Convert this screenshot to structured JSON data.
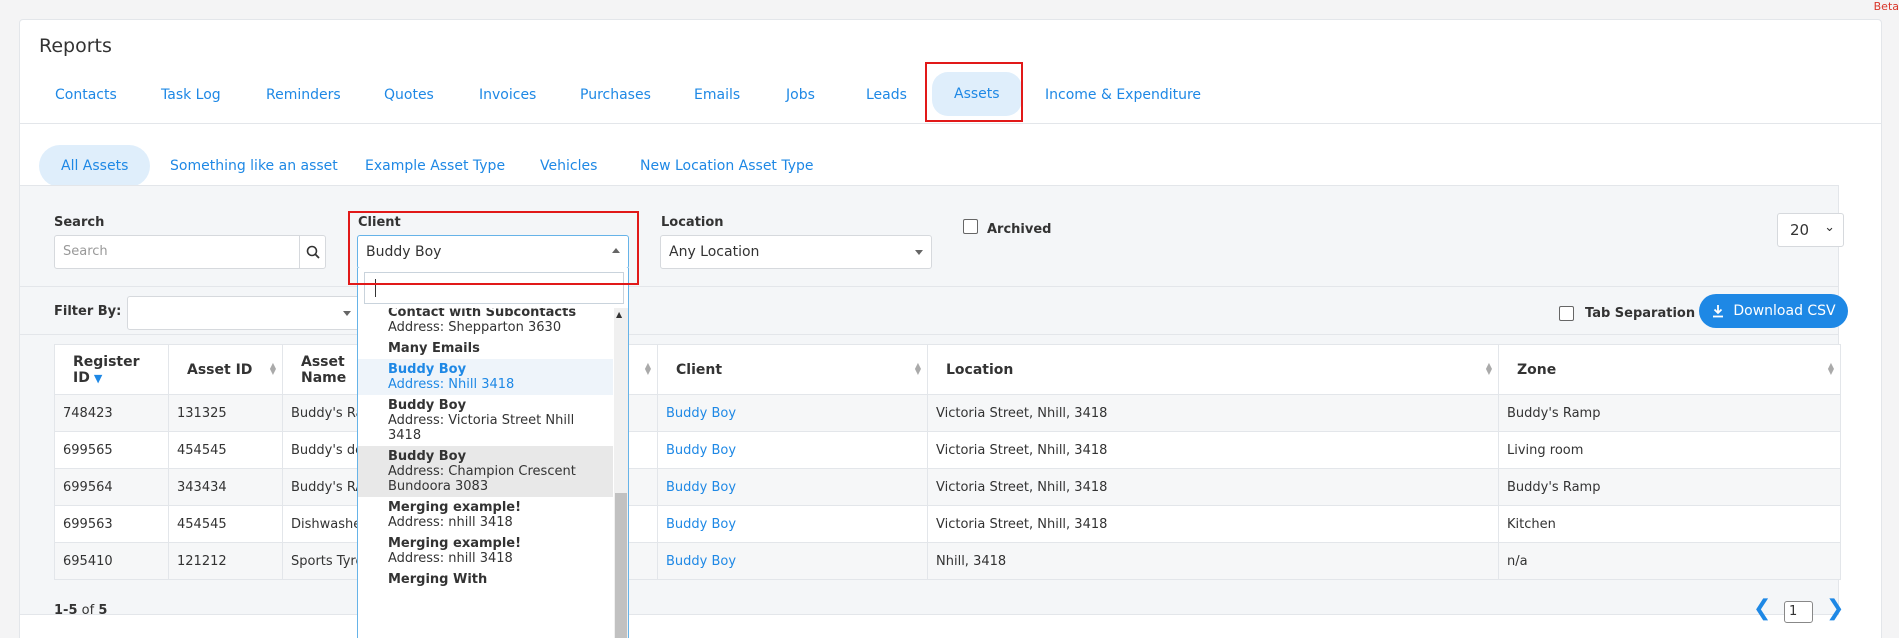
{
  "beta": "Beta",
  "page": {
    "title": "Reports"
  },
  "main_tabs": [
    {
      "label": "Contacts"
    },
    {
      "label": "Task Log"
    },
    {
      "label": "Reminders"
    },
    {
      "label": "Quotes"
    },
    {
      "label": "Invoices"
    },
    {
      "label": "Purchases"
    },
    {
      "label": "Emails"
    },
    {
      "label": "Jobs"
    },
    {
      "label": "Leads"
    },
    {
      "label": "Assets",
      "active": true
    },
    {
      "label": "Income & Expenditure"
    }
  ],
  "sub_tabs": [
    {
      "label": "All Assets",
      "active": true
    },
    {
      "label": "Something like an asset"
    },
    {
      "label": "Example Asset Type"
    },
    {
      "label": "Vehicles"
    },
    {
      "label": "New Location Asset Type"
    }
  ],
  "filters": {
    "search_label": "Search",
    "search_placeholder": "Search",
    "client_label": "Client",
    "client_value": "Buddy Boy",
    "location_label": "Location",
    "location_value": "Any Location",
    "archived_label": "Archived",
    "per_page": "20",
    "filter_by_label": "Filter By:",
    "tab_separation_label": "Tab Separation",
    "download_label": "Download CSV"
  },
  "client_dropdown": {
    "items": [
      {
        "name": "Contact with Subcontacts",
        "address": "Address: Shepparton 3630"
      },
      {
        "name": "Many Emails",
        "address": ""
      },
      {
        "name": "Buddy Boy",
        "address": "Address: Nhill 3418",
        "state": "hover"
      },
      {
        "name": "Buddy Boy",
        "address": "Address: Victoria Street Nhill 3418"
      },
      {
        "name": "Buddy Boy",
        "address": "Address: Champion Crescent Bundoora 3083",
        "state": "selected"
      },
      {
        "name": "Merging example!",
        "address": "Address: nhill 3418"
      },
      {
        "name": "Merging example!",
        "address": "Address: nhill 3418"
      },
      {
        "name": "Merging With",
        "address": ""
      }
    ]
  },
  "table": {
    "columns": [
      "Register ID",
      "Asset ID",
      "Asset Name",
      "",
      "Client",
      "Location",
      "Zone"
    ],
    "rows": [
      {
        "register_id": "748423",
        "asset_id": "131325",
        "asset_name": "Buddy's Ra",
        "client": "Buddy Boy",
        "location": "Victoria Street, Nhill, 3418",
        "zone": "Buddy's Ramp"
      },
      {
        "register_id": "699565",
        "asset_id": "454545",
        "asset_name": "Buddy's de",
        "client": "Buddy Boy",
        "location": "Victoria Street, Nhill, 3418",
        "zone": "Living room"
      },
      {
        "register_id": "699564",
        "asset_id": "343434",
        "asset_name": "Buddy's RA",
        "client": "Buddy Boy",
        "location": "Victoria Street, Nhill, 3418",
        "zone": "Buddy's Ramp"
      },
      {
        "register_id": "699563",
        "asset_id": "454545",
        "asset_name": "Dishwashe",
        "client": "Buddy Boy",
        "location": "Victoria Street, Nhill, 3418",
        "zone": "Kitchen"
      },
      {
        "register_id": "695410",
        "asset_id": "121212",
        "asset_name": "Sports Tyre",
        "client": "Buddy Boy",
        "location": "Nhill, 3418",
        "zone": "n/a"
      }
    ]
  },
  "footer": {
    "range": "1-5",
    "of": "of",
    "total": "5",
    "page": "1"
  },
  "colors": {
    "accent": "#1e88e5",
    "highlight": "#e11919"
  }
}
